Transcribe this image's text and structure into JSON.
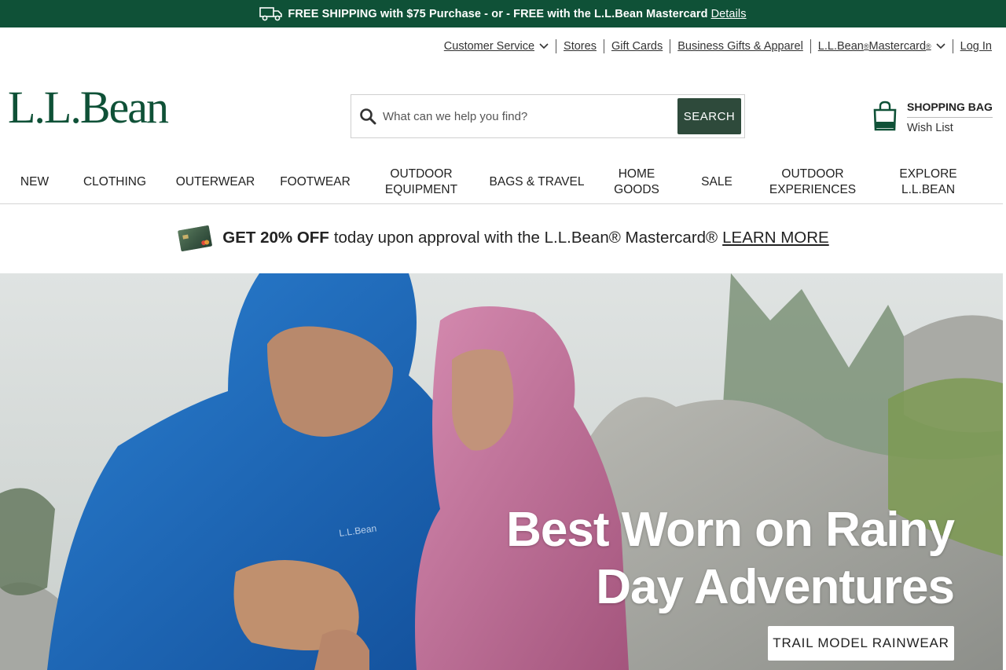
{
  "promo": {
    "text": "FREE SHIPPING with $75 Purchase - or - FREE with the L.L.Bean Mastercard",
    "details_label": "Details",
    "icon": "truck-icon"
  },
  "utility_nav": {
    "customer_service": "Customer Service",
    "stores": "Stores",
    "gift_cards": "Gift Cards",
    "business_gifts": "Business Gifts & Apparel",
    "mastercard_prefix": "L.L.Bean",
    "mastercard_middle": " Mastercard",
    "registered": "®",
    "log_in": "Log In"
  },
  "logo": {
    "text": "L.L.Bean"
  },
  "search": {
    "placeholder": "What can we help you find?",
    "value": "",
    "button_label": "SEARCH"
  },
  "bag": {
    "title": "SHOPPING BAG",
    "wish_list": "Wish List"
  },
  "main_nav": {
    "new": "New",
    "clothing": "Clothing",
    "outerwear": "Outerwear",
    "footwear": "Footwear",
    "outdoor_equipment": "Outdoor\nEquipment",
    "bags_travel": "Bags & Travel",
    "home_goods": "Home\nGoods",
    "sale": "Sale",
    "outdoor_experiences": "Outdoor\nExperiences",
    "explore": "Explore\nL.L.Bean"
  },
  "mc_banner": {
    "bold": "GET 20% OFF",
    "text": "today upon approval with the L.L.Bean® Mastercard®",
    "learn_more": "LEARN MORE"
  },
  "hero": {
    "headline_line1": "Best Worn on Rainy",
    "headline_line2": "Day Adventures",
    "cta_label": "TRAIL MODEL RAINWEAR",
    "jacket_brand": "L.L.Bean"
  },
  "colors": {
    "brand_green": "#0f5137",
    "search_button": "#2e4a3b"
  }
}
